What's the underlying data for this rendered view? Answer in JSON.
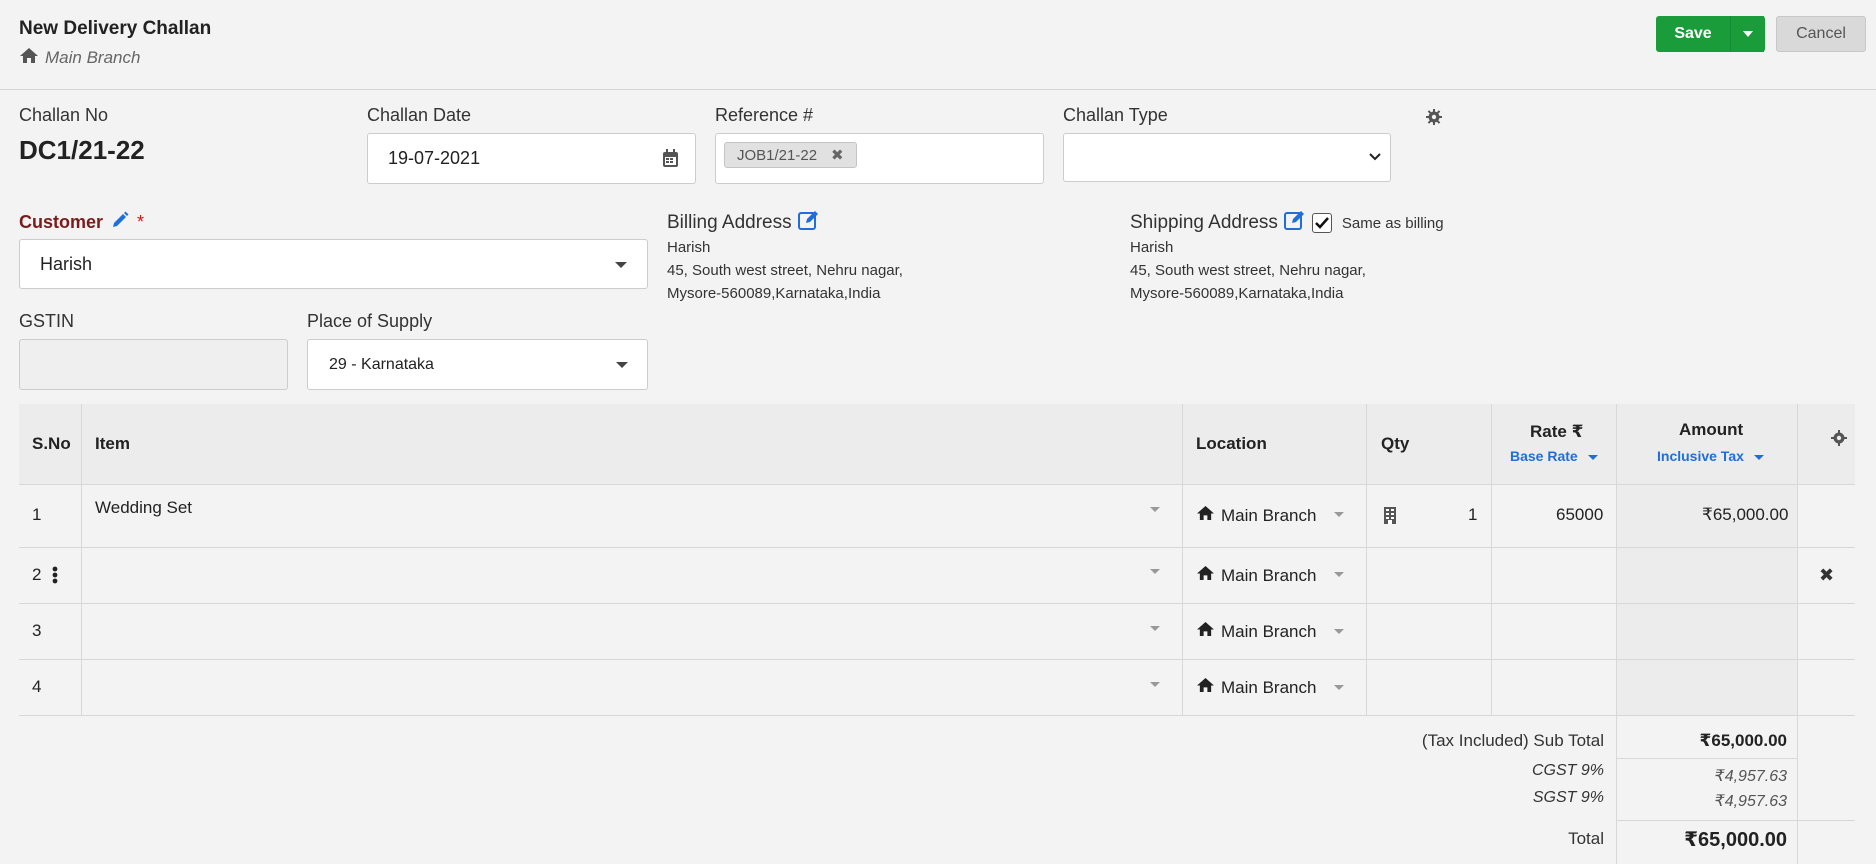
{
  "header": {
    "title": "New Delivery Challan",
    "branch": "Main Branch",
    "save_label": "Save",
    "cancel_label": "Cancel"
  },
  "form": {
    "challan_no_label": "Challan No",
    "challan_no": "DC1/21-22",
    "challan_date_label": "Challan Date",
    "challan_date": "19-07-2021",
    "reference_label": "Reference #",
    "reference_tag": "JOB1/21-22",
    "challan_type_label": "Challan Type",
    "challan_type_value": "",
    "customer_label": "Customer",
    "required_mark": "*",
    "customer_value": "Harish",
    "gstin_label": "GSTIN",
    "gstin_value": "",
    "place_of_supply_label": "Place of Supply",
    "place_of_supply_value": "29 - Karnataka"
  },
  "billing": {
    "label": "Billing Address",
    "name": "Harish",
    "line1": "45, South west street, Nehru nagar,",
    "line2": "Mysore-560089,Karnataka,India"
  },
  "shipping": {
    "label": "Shipping Address",
    "same_as_billing_label": "Same as billing",
    "same_as_billing_checked": true,
    "name": "Harish",
    "line1": "45, South west street, Nehru nagar,",
    "line2": "Mysore-560089,Karnataka,India"
  },
  "table": {
    "headers": {
      "sno": "S.No",
      "item": "Item",
      "location": "Location",
      "qty": "Qty",
      "rate": "Rate ₹",
      "rate_sub": "Base Rate",
      "amount": "Amount",
      "amount_sub": "Inclusive Tax"
    },
    "rows": [
      {
        "sno": "1",
        "item": "Wedding Set",
        "location": "Main Branch",
        "qty": "1",
        "rate": "65000",
        "amount": "₹65,000.00"
      },
      {
        "sno": "2",
        "item": "",
        "location": "Main Branch",
        "qty": "",
        "rate": "",
        "amount": ""
      },
      {
        "sno": "3",
        "item": "",
        "location": "Main Branch",
        "qty": "",
        "rate": "",
        "amount": ""
      },
      {
        "sno": "4",
        "item": "",
        "location": "Main Branch",
        "qty": "",
        "rate": "",
        "amount": ""
      }
    ]
  },
  "totals": {
    "subtotal_label": "(Tax Included) Sub Total",
    "subtotal_value": "₹65,000.00",
    "cgst_label": "CGST 9%",
    "cgst_value": "₹4,957.63",
    "sgst_label": "SGST 9%",
    "sgst_value": "₹4,957.63",
    "total_label": "Total",
    "total_value": "₹65,000.00"
  },
  "colors": {
    "save_green": "#1b9c3b",
    "link_blue": "#1e6fd9",
    "customer_label": "#7a1c1c"
  }
}
